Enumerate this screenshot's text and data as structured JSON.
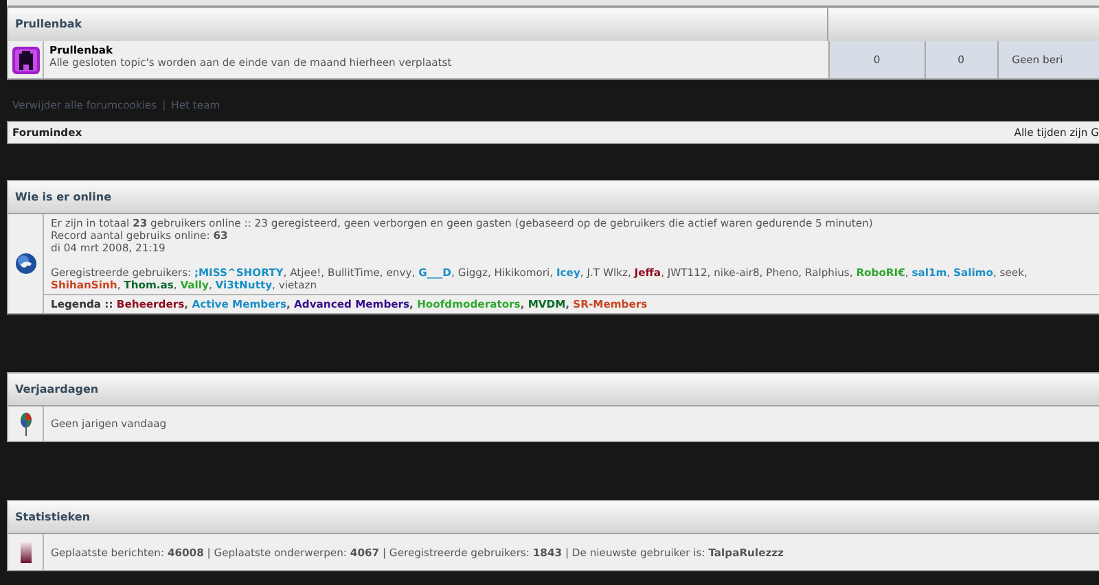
{
  "forum_category": {
    "title": "Prullenbak",
    "forums": [
      {
        "name": "Prullenbak",
        "description": "Alle gesloten topic's worden aan de einde van de maand hierheen verplaatst",
        "stat_1": "0",
        "stat_2": "0",
        "stat_3": "Geen beri"
      }
    ]
  },
  "footer_links": [
    {
      "label": "Verwijder alle forumcookies"
    },
    {
      "label": "Het team"
    }
  ],
  "footer_separator": "|",
  "breadcrumb_bar": {
    "left": "Forumindex",
    "right": "Alle tijden zijn G"
  },
  "online": {
    "title": "Wie is er online",
    "lines": [
      "Er zijn in totaal **23** gebruikers online :: 23 geregisteerd, geen verborgen en geen gasten (gebaseerd op de gebruikers die actief waren gedurende 5 minuten)",
      "Record aantal gebruiks online: **63**",
      "di 04 mrt 2008, 21:19"
    ],
    "registered_label": "Geregistreerde gebruikers:",
    "list_separator": ",",
    "users": [
      {
        "name": ";MISS^SHORTY",
        "color": "#1a8fc8",
        "bold": true
      },
      {
        "name": "Atjee!",
        "color": "#555555",
        "bold": false
      },
      {
        "name": "BullitTime",
        "color": "#555555",
        "bold": false
      },
      {
        "name": "envy",
        "color": "#555555",
        "bold": false
      },
      {
        "name": "G___D",
        "color": "#1a8fc8",
        "bold": true
      },
      {
        "name": "Giggz",
        "color": "#555555",
        "bold": false
      },
      {
        "name": "Hikikomori",
        "color": "#555555",
        "bold": false
      },
      {
        "name": "Icey",
        "color": "#1a8fc8",
        "bold": true
      },
      {
        "name": "J.T Wlkz",
        "color": "#555555",
        "bold": false
      },
      {
        "name": "Jeffa",
        "color": "#8b0a1a",
        "bold": true
      },
      {
        "name": "JWT112",
        "color": "#555555",
        "bold": false
      },
      {
        "name": "nike-air8",
        "color": "#555555",
        "bold": false
      },
      {
        "name": "Pheno",
        "color": "#555555",
        "bold": false
      },
      {
        "name": "Ralphius",
        "color": "#555555",
        "bold": false
      },
      {
        "name": "RoboRI€",
        "color": "#2ea82e",
        "bold": true
      },
      {
        "name": "sal1m",
        "color": "#1a8fc8",
        "bold": true
      },
      {
        "name": "Salimo",
        "color": "#1a8fc8",
        "bold": true
      },
      {
        "name": "seek",
        "color": "#555555",
        "bold": false
      },
      {
        "name": "ShihanSinh",
        "color": "#cc4420",
        "bold": true
      },
      {
        "name": "Thom.as",
        "color": "#0a6a2a",
        "bold": true
      },
      {
        "name": "Vally",
        "color": "#2ea82e",
        "bold": true
      },
      {
        "name": "Vi3tNutty",
        "color": "#1a8fc8",
        "bold": true
      },
      {
        "name": "vietazn",
        "color": "#555555",
        "bold": false
      }
    ],
    "legend_label": "Legenda ::",
    "legend": [
      {
        "name": "Beheerders",
        "color": "#8b0a1a"
      },
      {
        "name": "Active Members",
        "color": "#1a8fc8"
      },
      {
        "name": "Advanced Members",
        "color": "#33108a"
      },
      {
        "name": "Hoofdmoderators",
        "color": "#2ea82e"
      },
      {
        "name": "MVDM",
        "color": "#0a6a2a"
      },
      {
        "name": "SR-Members",
        "color": "#cc4420"
      }
    ]
  },
  "birthdays": {
    "title": "Verjaardagen",
    "text": "Geen jarigen vandaag"
  },
  "statistics": {
    "title": "Statistieken",
    "text": "Geplaatste berichten: **46008** | Geplaatste onderwerpen: **4067** | Geregistreerde gebruikers: **1843** | De nieuwste gebruiker is: **TalpaRulezzz**"
  }
}
